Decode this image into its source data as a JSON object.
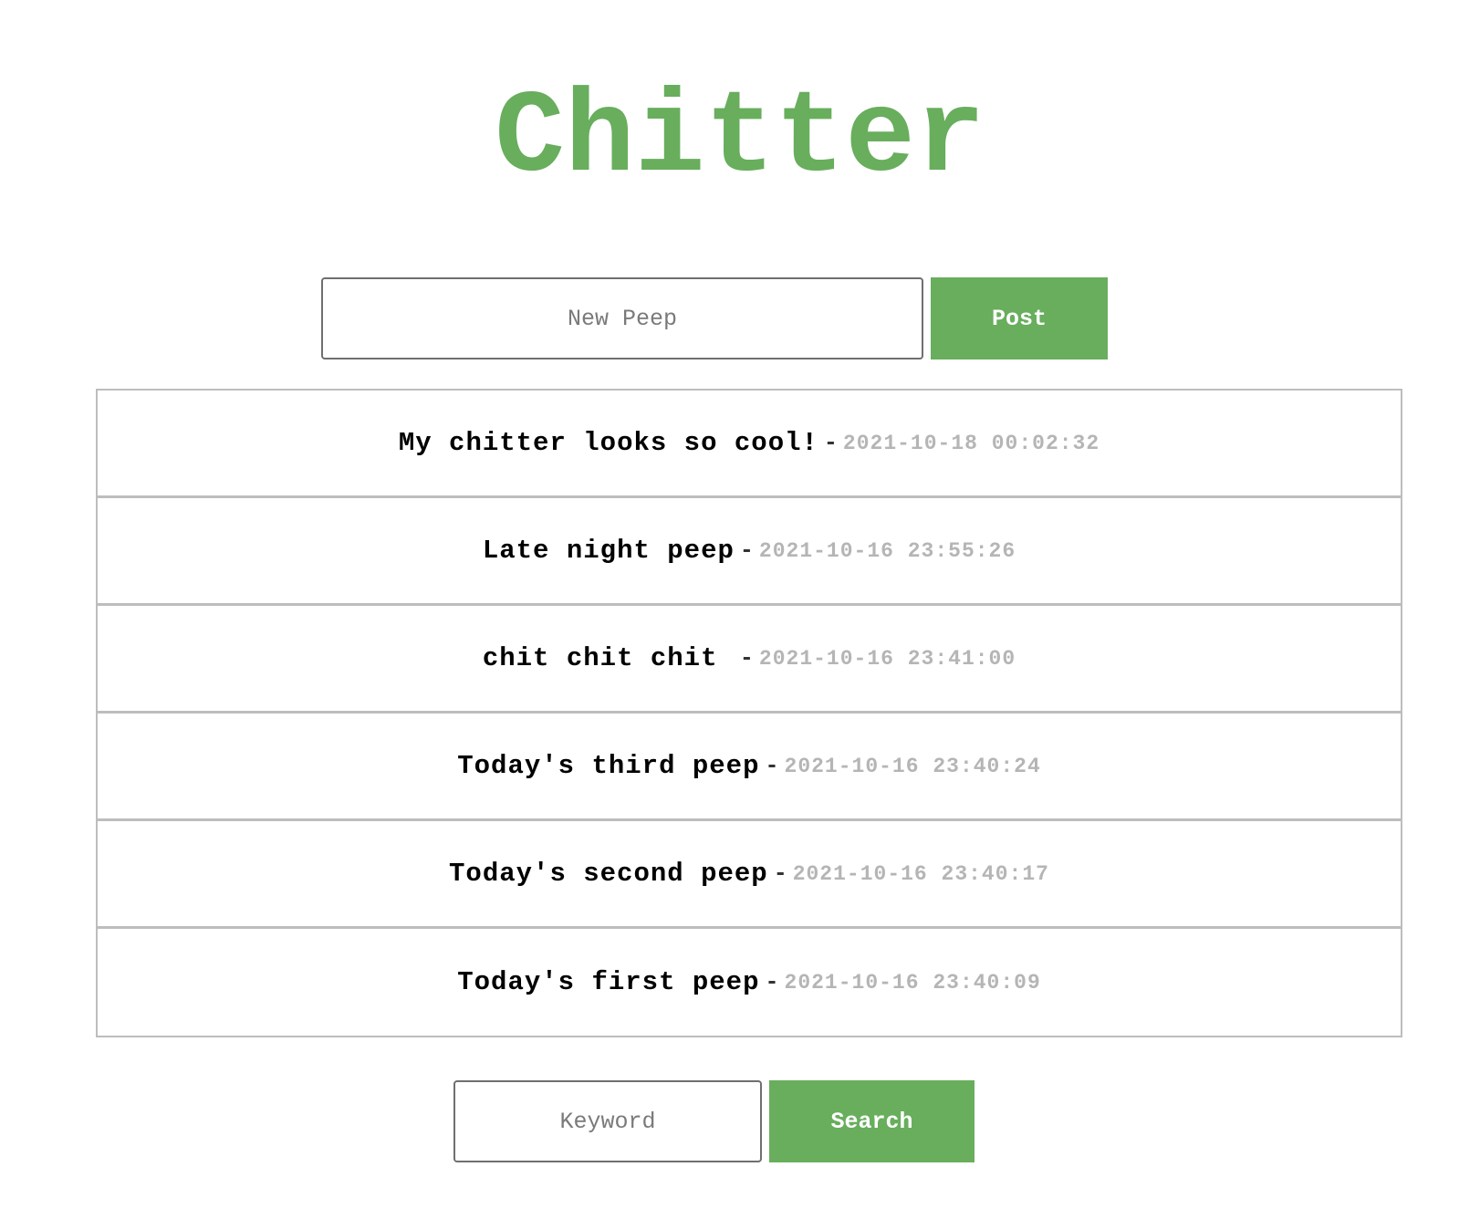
{
  "app": {
    "title": "Chitter"
  },
  "post_form": {
    "placeholder": "New Peep",
    "value": "",
    "button_label": "Post"
  },
  "peeps": [
    {
      "text": "My chitter looks so cool!",
      "separator": "-",
      "timestamp": "2021-10-18 00:02:32"
    },
    {
      "text": "Late night peep",
      "separator": "-",
      "timestamp": "2021-10-16 23:55:26"
    },
    {
      "text": "chit chit chit ",
      "separator": "-",
      "timestamp": "2021-10-16 23:41:00"
    },
    {
      "text": "Today's third peep",
      "separator": "-",
      "timestamp": "2021-10-16 23:40:24"
    },
    {
      "text": "Today's second peep",
      "separator": "-",
      "timestamp": "2021-10-16 23:40:17"
    },
    {
      "text": "Today's first peep",
      "separator": "-",
      "timestamp": "2021-10-16 23:40:09"
    }
  ],
  "search_form": {
    "placeholder": "Keyword",
    "value": "",
    "button_label": "Search"
  },
  "colors": {
    "brand_green": "#68ae5d",
    "timestamp_gray": "#b5b5b5",
    "border_gray": "#bdbdbd"
  }
}
